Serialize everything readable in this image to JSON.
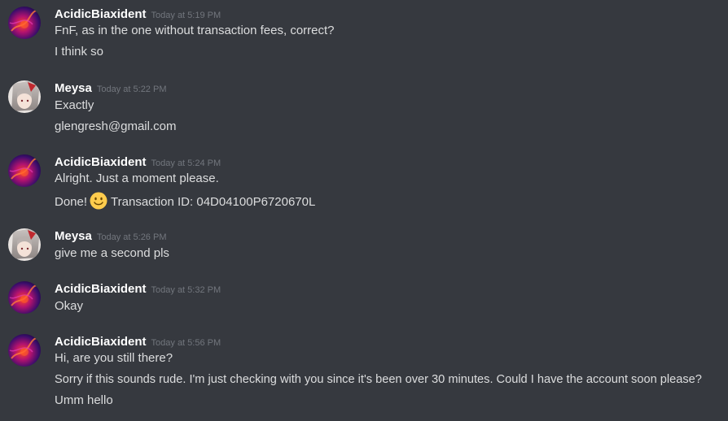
{
  "messages": [
    {
      "author": "AcidicBiaxident",
      "timestamp": "Today at 5:19 PM",
      "lines": [
        "FnF, as in the one without transaction fees, correct?",
        "I think so"
      ]
    },
    {
      "author": "Meysa",
      "timestamp": "Today at 5:22 PM",
      "lines": [
        "Exactly",
        "glengresh@gmail.com"
      ]
    },
    {
      "author": "AcidicBiaxident",
      "timestamp": "Today at 5:24 PM",
      "lines": [
        "Alright. Just a moment please."
      ],
      "emoji_line": {
        "before": "Done!",
        "emoji": "slightly-smiling-face-icon",
        "after": "Transaction ID: 04D04100P6720670L"
      }
    },
    {
      "author": "Meysa",
      "timestamp": "Today at 5:26 PM",
      "lines": [
        "give me a second pls"
      ]
    },
    {
      "author": "AcidicBiaxident",
      "timestamp": "Today at 5:32 PM",
      "lines": [
        "Okay"
      ]
    },
    {
      "author": "AcidicBiaxident",
      "timestamp": "Today at 5:56 PM",
      "lines": [
        "Hi, are you still there?",
        "Sorry if this sounds rude. I'm just checking with you since it's been over 30 minutes. Could I have the account soon please?",
        "Umm hello"
      ]
    }
  ],
  "colors": {
    "background": "#36393f",
    "username": "#ffffff",
    "timestamp": "#72767d",
    "message_text": "#dcddde"
  }
}
